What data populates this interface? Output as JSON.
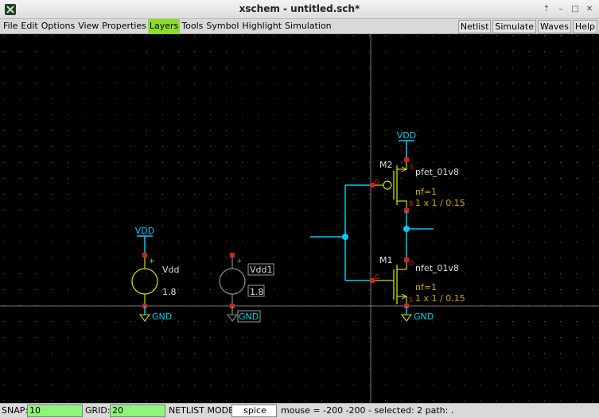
{
  "window": {
    "title": "xschem - untitled.sch*"
  },
  "menu": [
    "File",
    "Edit",
    "Options",
    "View",
    "Properties",
    "Layers",
    "Tools",
    "Symbol",
    "Highlight",
    "Simulation"
  ],
  "active_menu": "Layers",
  "right_buttons": [
    "Netlist",
    "Simulate",
    "Waves",
    "Help"
  ],
  "schematic": {
    "vsrc_vdd": {
      "net_label": "VDD",
      "name": "Vdd",
      "value": "1.8",
      "gnd_label": "GND"
    },
    "vsrc_vdd1": {
      "name": "Vdd1",
      "value": "1.8",
      "gnd_label": "GND"
    },
    "pmos": {
      "instance": "M2",
      "model": "pfet_01v8",
      "nf": "nf=1",
      "size": "1 x 1 / 0.15",
      "pin_g": "G",
      "pin_s": "S",
      "pin_b": "B",
      "supply": "VDD"
    },
    "nmos": {
      "instance": "M1",
      "model": "nfet_01v8",
      "nf": "nf=1",
      "size": "1 x 1 / 0.15",
      "pin_g": "G",
      "pin_d": "D",
      "pin_s": "S",
      "gnd_label": "GND"
    }
  },
  "status": {
    "snap_label": "SNAP:",
    "snap_value": "10",
    "grid_label": "GRID:",
    "grid_value": "20",
    "netlist_label": "NETLIST MODE:",
    "netlist_value": "spice",
    "info": "mouse = -200 -200 - selected: 2 path: ."
  },
  "colors": {
    "wire": "#00ccee",
    "symbol": "#ccdd00",
    "pin": "#cc2222",
    "menu_active": "#8ddc2c",
    "field_green": "#8ef57c"
  }
}
